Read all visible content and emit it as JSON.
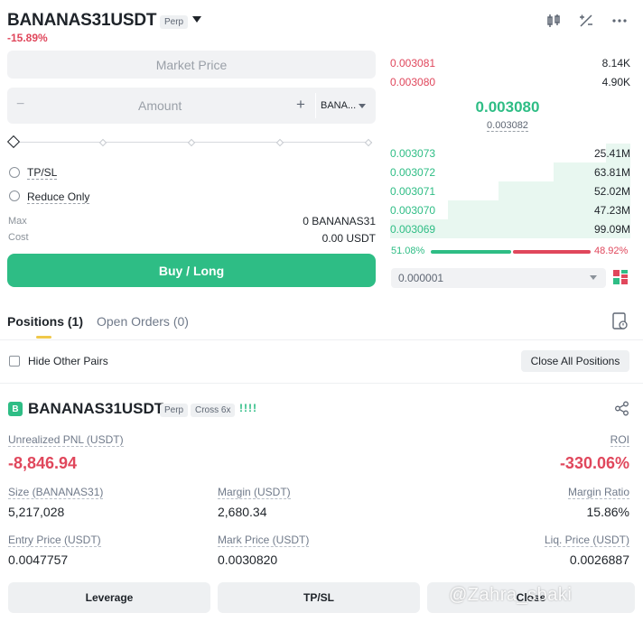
{
  "header": {
    "symbol": "BANANAS31USDT",
    "badge": "Perp",
    "change": "-15.89%",
    "icons": [
      "candlestick-icon",
      "calculator-icon",
      "more-icon"
    ]
  },
  "order_form": {
    "market_price": "Market Price",
    "amount_placeholder": "Amount",
    "minus": "−",
    "plus": "+",
    "unit": "BANA...",
    "tpsl": "TP/SL",
    "reduce_only": "Reduce Only",
    "max_label": "Max",
    "max_value": "0 BANANAS31",
    "cost_label": "Cost",
    "cost_value": "0.00 USDT",
    "buy_label": "Buy / Long"
  },
  "order_book": {
    "asks": [
      {
        "price": "0.003081",
        "qty": "8.14K"
      },
      {
        "price": "0.003080",
        "qty": "4.90K"
      }
    ],
    "last_price": "0.003080",
    "mark_price": "0.003082",
    "bids": [
      {
        "price": "0.003073",
        "qty": "25.41M",
        "depth": 0.1
      },
      {
        "price": "0.003072",
        "qty": "63.81M",
        "depth": 0.32
      },
      {
        "price": "0.003071",
        "qty": "52.02M",
        "depth": 0.55
      },
      {
        "price": "0.003070",
        "qty": "47.23M",
        "depth": 0.76
      },
      {
        "price": "0.003069",
        "qty": "99.09M",
        "depth": 1.0
      }
    ],
    "buy_ratio": "51.08%",
    "sell_ratio": "48.92%",
    "buy_ratio_value": 0.5108,
    "precision": "0.000001"
  },
  "positions": {
    "tab_positions": "Positions (1)",
    "tab_orders": "Open Orders (0)",
    "hide_other": "Hide Other Pairs",
    "close_all": "Close All Positions",
    "card": {
      "icon_letter": "B",
      "symbol": "BANANAS31USDT",
      "badge": "Perp",
      "mode": "Cross 6x",
      "bars": "!!!!",
      "unrealized_label": "Unrealized PNL (USDT)",
      "unrealized_value": "-8,846.94",
      "roi_label": "ROI",
      "roi_value": "-330.06%",
      "size_label": "Size (BANANAS31)",
      "size_value": "5,217,028",
      "margin_label": "Margin (USDT)",
      "margin_value": "2,680.34",
      "margin_ratio_label": "Margin Ratio",
      "margin_ratio_value": "15.86%",
      "entry_label": "Entry Price (USDT)",
      "entry_value": "0.0047757",
      "mark_label": "Mark Price (USDT)",
      "mark_value": "0.0030820",
      "liq_label": "Liq. Price (USDT)",
      "liq_value": "0.0026887"
    },
    "buttons": {
      "leverage": "Leverage",
      "tpsl": "TP/SL",
      "close": "Close"
    }
  },
  "watermark": "@Zahra_sbaki",
  "colors": {
    "green": "#2ebd85",
    "red": "#e0475c",
    "accent": "#f0c84a"
  }
}
